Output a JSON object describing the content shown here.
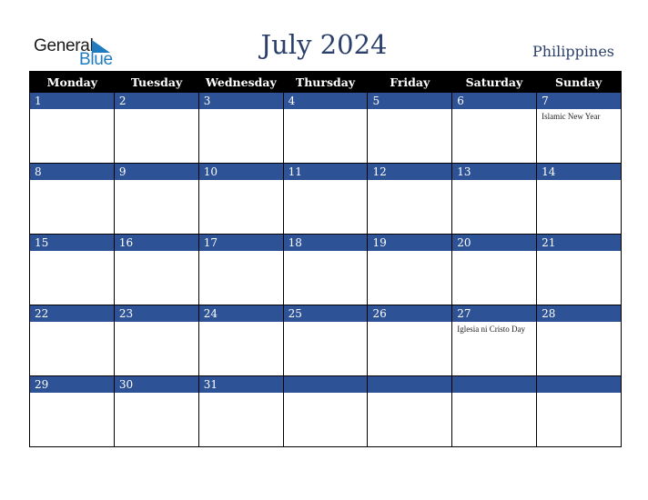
{
  "logo": {
    "general": "General",
    "blue": "Blue"
  },
  "title": "July 2024",
  "country": "Philippines",
  "weekdays": [
    "Monday",
    "Tuesday",
    "Wednesday",
    "Thursday",
    "Friday",
    "Saturday",
    "Sunday"
  ],
  "weeks": [
    [
      {
        "d": "1",
        "e": ""
      },
      {
        "d": "2",
        "e": ""
      },
      {
        "d": "3",
        "e": ""
      },
      {
        "d": "4",
        "e": ""
      },
      {
        "d": "5",
        "e": ""
      },
      {
        "d": "6",
        "e": ""
      },
      {
        "d": "7",
        "e": "Islamic New Year"
      }
    ],
    [
      {
        "d": "8",
        "e": ""
      },
      {
        "d": "9",
        "e": ""
      },
      {
        "d": "10",
        "e": ""
      },
      {
        "d": "11",
        "e": ""
      },
      {
        "d": "12",
        "e": ""
      },
      {
        "d": "13",
        "e": ""
      },
      {
        "d": "14",
        "e": ""
      }
    ],
    [
      {
        "d": "15",
        "e": ""
      },
      {
        "d": "16",
        "e": ""
      },
      {
        "d": "17",
        "e": ""
      },
      {
        "d": "18",
        "e": ""
      },
      {
        "d": "19",
        "e": ""
      },
      {
        "d": "20",
        "e": ""
      },
      {
        "d": "21",
        "e": ""
      }
    ],
    [
      {
        "d": "22",
        "e": ""
      },
      {
        "d": "23",
        "e": ""
      },
      {
        "d": "24",
        "e": ""
      },
      {
        "d": "25",
        "e": ""
      },
      {
        "d": "26",
        "e": ""
      },
      {
        "d": "27",
        "e": "Iglesia ni Cristo Day"
      },
      {
        "d": "28",
        "e": ""
      }
    ],
    [
      {
        "d": "29",
        "e": ""
      },
      {
        "d": "30",
        "e": ""
      },
      {
        "d": "31",
        "e": ""
      },
      {
        "d": "",
        "e": ""
      },
      {
        "d": "",
        "e": ""
      },
      {
        "d": "",
        "e": ""
      },
      {
        "d": "",
        "e": ""
      }
    ]
  ],
  "colors": {
    "header_bg": "#000000",
    "day_strip": "#2d5295",
    "title": "#2b3f6b",
    "logo_blue": "#1f7bc0"
  }
}
